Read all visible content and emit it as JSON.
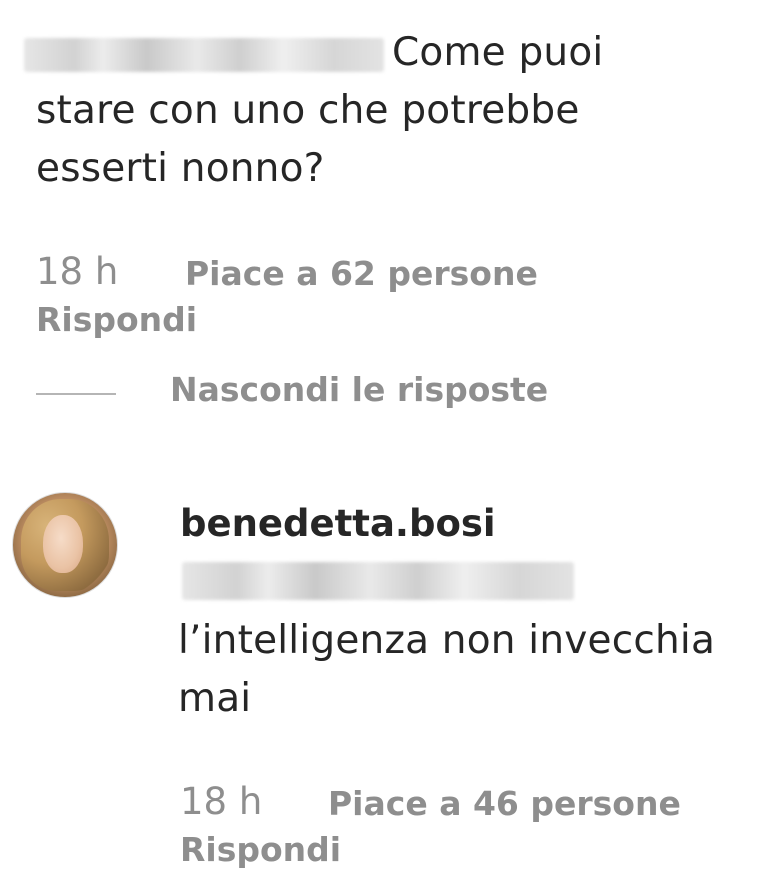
{
  "comment1": {
    "text_line1": "Come puoi",
    "text_line2": "stare con uno che potrebbe",
    "text_line3": "esserti nonno?",
    "time": "18 h",
    "likes": "Piace a 62 persone",
    "reply": "Rispondi",
    "hide_replies": "Nascondi le risposte"
  },
  "reply1": {
    "username": "benedetta.bosi",
    "text_line1": "l’intelligenza non invecchia",
    "text_line2": "mai",
    "time": "18 h",
    "likes": "Piace a 46 persone",
    "reply": "Rispondi"
  }
}
